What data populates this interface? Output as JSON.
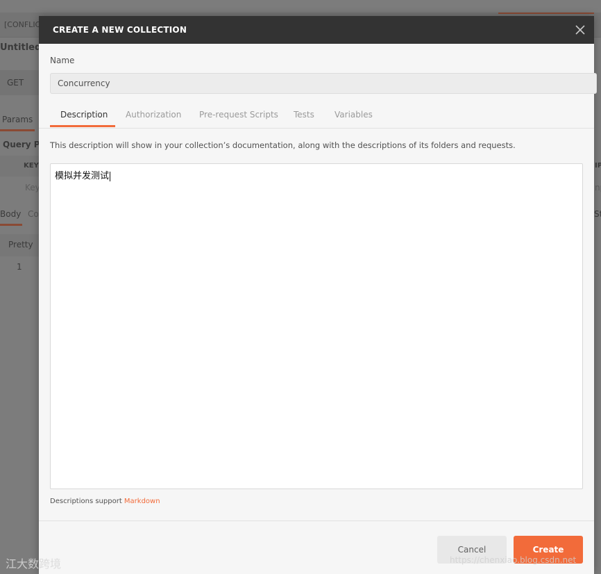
{
  "background": {
    "tab_label": "[CONFLIC",
    "request_title": "Untitled R",
    "method": "GET",
    "params_tab": "Params",
    "query_label": "Query Pa",
    "key_header": "KEY",
    "key_placeholder": "Key",
    "body_tab": "Body",
    "cookies_tab": "Co",
    "pretty_label": "Pretty",
    "line_number": "1",
    "right_fragment_1": "IP",
    "right_fragment_2": "np",
    "right_fragment_3": "Sta"
  },
  "modal": {
    "title": "CREATE A NEW COLLECTION",
    "close_icon": "close-icon",
    "name_label": "Name",
    "name_value": "Concurrency",
    "tabs": [
      {
        "label": "Description",
        "active": true
      },
      {
        "label": "Authorization",
        "active": false
      },
      {
        "label": "Pre-request Scripts",
        "active": false
      },
      {
        "label": "Tests",
        "active": false
      },
      {
        "label": "Variables",
        "active": false
      }
    ],
    "description_help": "This description will show in your collection’s documentation, along with the descriptions of its folders and requests.",
    "description_value": "模拟并发测试",
    "markdown_note": "Descriptions support ",
    "markdown_link": "Markdown",
    "cancel_label": "Cancel",
    "create_label": "Create"
  },
  "watermarks": {
    "left": "江大数跨境",
    "right": "https://chenxiao.blog.csdn.net"
  },
  "colors": {
    "accent": "#f26b3a",
    "header_bg": "#333333",
    "overlay_bg": "#7c7c7c"
  }
}
